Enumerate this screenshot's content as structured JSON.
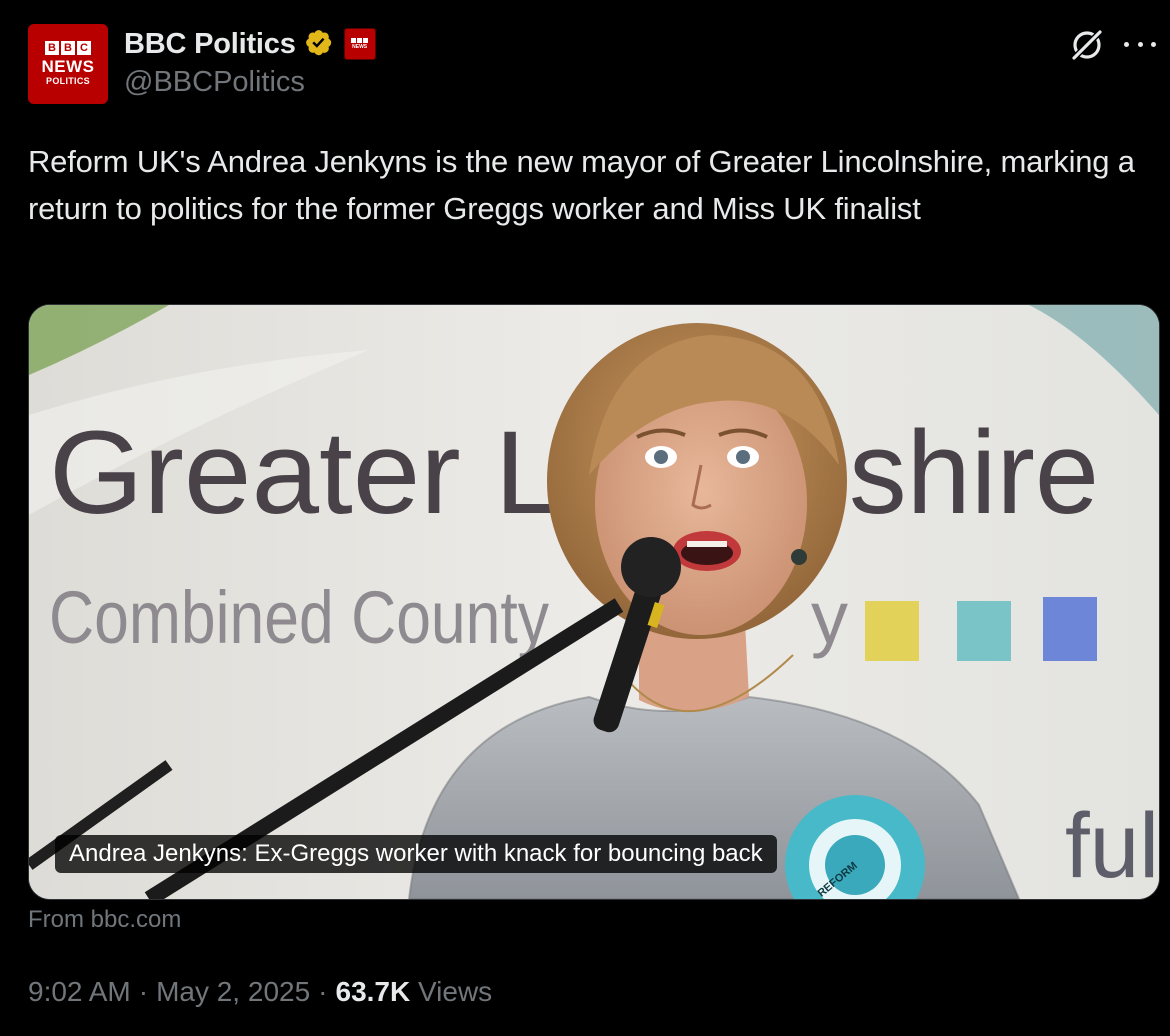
{
  "account": {
    "display_name": "BBC Politics",
    "handle": "@BBCPolitics",
    "avatar_text": {
      "brand": "BBC",
      "line1": "NEWS",
      "line2": "POLITICS"
    },
    "affiliate_badge_text": "NEWS"
  },
  "icons": {
    "verified": "verified-badge-icon",
    "affiliate": "bbc-news-affiliate-icon",
    "grok": "grok-icon",
    "more": "more-options-icon"
  },
  "tweet": {
    "text": "Reform UK's Andrea Jenkyns is the new mayor of Greater Lincolnshire, marking a return to politics for the former Greggs worker and Miss UK finalist"
  },
  "card": {
    "caption": "Andrea Jenkyns: Ex-Greggs worker with knack for bouncing back",
    "source": "From bbc.com",
    "image_sign_text": {
      "big_left": "Greater Li",
      "big_right": "shire",
      "small": "Combined County",
      "small_tail": "y",
      "bottom_right": "ful",
      "rosette": "REFORM"
    }
  },
  "meta": {
    "time": "9:02 AM",
    "date": "May 2, 2025",
    "views_count": "63.7K",
    "views_label": "Views",
    "separator": "·"
  },
  "colors": {
    "background": "#000000",
    "primary_text": "#e7e9ea",
    "secondary_text": "#71767b",
    "bbc_red": "#b80000",
    "verified_gold": "#e2b719"
  }
}
